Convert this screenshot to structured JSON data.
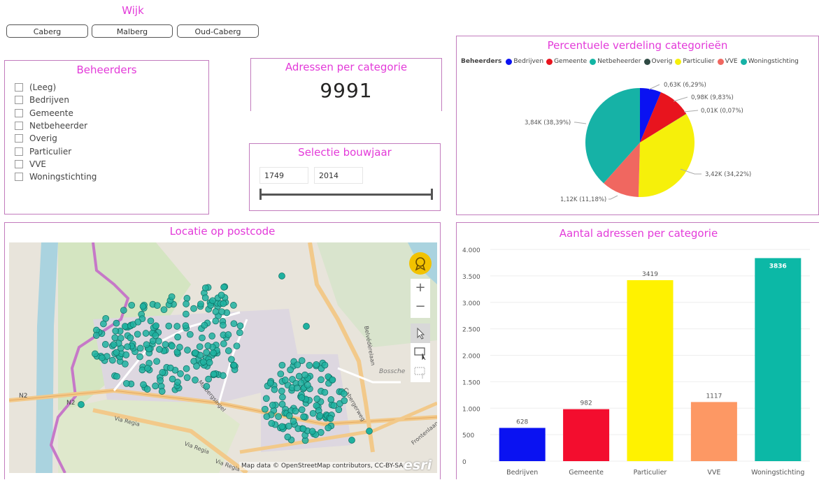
{
  "wijk": {
    "title": "Wijk",
    "buttons": [
      "Caberg",
      "Malberg",
      "Oud-Caberg"
    ]
  },
  "beheerders": {
    "title": "Beheerders",
    "items": [
      "(Leeg)",
      "Bedrijven",
      "Gemeente",
      "Netbeheerder",
      "Overig",
      "Particulier",
      "VVE",
      "Woningstichting"
    ]
  },
  "kpi": {
    "title": "Adressen per categorie",
    "value": "9991"
  },
  "bouwjaar": {
    "title": "Selectie bouwjaar",
    "min": "1749",
    "max": "2014"
  },
  "pie": {
    "title": "Percentuele verdeling categorieën",
    "legend_title": "Beheerders",
    "legend": [
      {
        "name": "Bedrijven",
        "color": "#0a12f2"
      },
      {
        "name": "Gemeente",
        "color": "#e8141e"
      },
      {
        "name": "Netbeheerder",
        "color": "#12b5a4"
      },
      {
        "name": "Overig",
        "color": "#2f4a44"
      },
      {
        "name": "Particulier",
        "color": "#f6f00a"
      },
      {
        "name": "VVE",
        "color": "#f06760"
      },
      {
        "name": "Woningstichting",
        "color": "#16b2a6"
      }
    ],
    "labels": [
      "0,63K (6,29%)",
      "0,98K (9,83%)",
      "0,01K (0,07%)",
      "3,42K (34,22%)",
      "1,12K (11,18%)",
      "3,84K (38,39%)"
    ]
  },
  "map": {
    "title": "Locatie op postcode",
    "attribution": "Map data © OpenStreetMap contributors, CC-BY-SA",
    "logo": "esri",
    "zoom_in": "+",
    "zoom_out": "−",
    "street_labels": [
      "N2",
      "N2",
      "Via Regia",
      "Via Regia",
      "Via Regia",
      "Malbergsingel",
      "Belvédèrelaan",
      "Bossche",
      "Cabergerweg",
      "Frontenlaan"
    ],
    "icons": [
      "award-icon",
      "pointer-icon",
      "rect-select-icon",
      "lasso-select-icon"
    ]
  },
  "chart_data": [
    {
      "type": "pie",
      "title": "Percentuele verdeling categorieën",
      "slices": [
        {
          "name": "Bedrijven",
          "value": 628,
          "percent": 6.29,
          "color": "#0a12f2"
        },
        {
          "name": "Gemeente",
          "value": 982,
          "percent": 9.83,
          "color": "#e8141e"
        },
        {
          "name": "Overig",
          "value": 7,
          "percent": 0.07,
          "color": "#2f4a44"
        },
        {
          "name": "Particulier",
          "value": 3419,
          "percent": 34.22,
          "color": "#f6f00a"
        },
        {
          "name": "VVE",
          "value": 1117,
          "percent": 11.18,
          "color": "#f06760"
        },
        {
          "name": "Woningstichting",
          "value": 3836,
          "percent": 38.39,
          "color": "#16b2a6"
        }
      ],
      "legend": "top-left"
    },
    {
      "type": "bar",
      "title": "Aantal adressen per categorie",
      "categories": [
        "Bedrijven",
        "Gemeente",
        "Particulier",
        "VVE",
        "Woningstichting"
      ],
      "values": [
        628,
        982,
        3419,
        1117,
        3836
      ],
      "colors": [
        "#0a12f2",
        "#f30d2e",
        "#fff200",
        "#fd9864",
        "#0cb8a6"
      ],
      "ylim": [
        0,
        4000
      ],
      "yticks": [
        "0",
        "500",
        "1.000",
        "1.500",
        "2.000",
        "2.500",
        "3.000",
        "3.500",
        "4.000"
      ],
      "grid": true
    }
  ]
}
